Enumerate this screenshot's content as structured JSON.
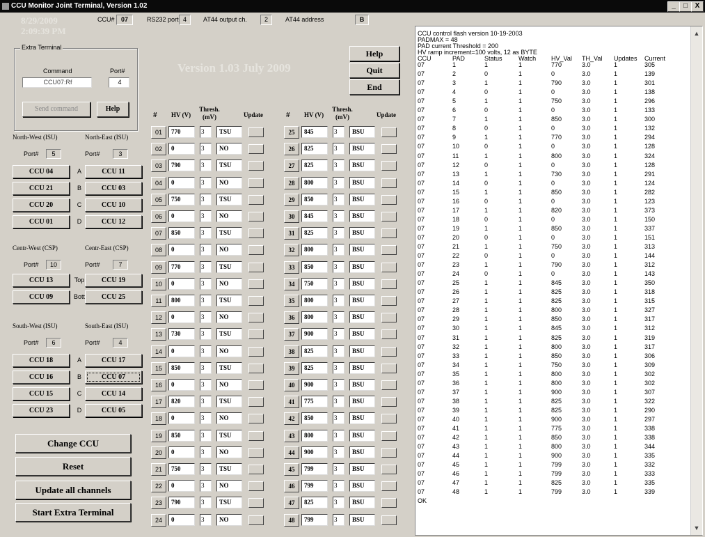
{
  "window": {
    "title": "CCU Monitor Joint Terminal, Version 1.02",
    "controls": [
      "_",
      "□",
      "X"
    ]
  },
  "ghost": {
    "date": "8/29/2009",
    "time": "2:09:39 PM",
    "version": "Version 1.03  July 2009"
  },
  "topbar": {
    "ccu_label": "CCU#",
    "ccu_value": "07",
    "rs232_label": "RS232 port#",
    "rs232_value": "4",
    "at44_ch_label": "AT44 output ch.",
    "at44_ch_value": "2",
    "at44_addr_label": "AT44 address",
    "at44_addr_value": "B"
  },
  "extra_terminal": {
    "title": "Extra Terminal",
    "command_label": "Command",
    "port_label": "Port#",
    "command_value": "CCU07:Rf",
    "port_value": "4",
    "send_label": "Send command",
    "help_label": "Help"
  },
  "side_buttons": {
    "help": "Help",
    "quit": "Quit",
    "end": "End"
  },
  "groups": [
    {
      "left_title": "North-West (ISU)",
      "right_title": "North-East (ISU)",
      "port_label": "Port#",
      "left_port": "5",
      "right_port": "3",
      "rows": [
        {
          "left": "CCU 04",
          "mid": "A",
          "right": "CCU 11"
        },
        {
          "left": "CCU 21",
          "mid": "B",
          "right": "CCU 03"
        },
        {
          "left": "CCU 20",
          "mid": "C",
          "right": "CCU 10"
        },
        {
          "left": "CCU 01",
          "mid": "D",
          "right": "CCU 12"
        }
      ]
    },
    {
      "left_title": "Centr-West (CSP)",
      "right_title": "Centr-East (CSP)",
      "port_label": "Port#",
      "left_port": "10",
      "right_port": "7",
      "rows": [
        {
          "left": "CCU 13",
          "mid": "Top",
          "right": "CCU 19"
        },
        {
          "left": "CCU 09",
          "mid": "Bott",
          "right": "CCU 25"
        }
      ]
    },
    {
      "left_title": "South-West (ISU)",
      "right_title": "South-East (ISU)",
      "port_label": "Port#",
      "left_port": "6",
      "right_port": "4",
      "rows": [
        {
          "left": "CCU 18",
          "mid": "A",
          "right": "CCU 17"
        },
        {
          "left": "CCU 16",
          "mid": "B",
          "right": "CCU 07"
        },
        {
          "left": "CCU 15",
          "mid": "C",
          "right": "CCU 14"
        },
        {
          "left": "CCU 23",
          "mid": "D",
          "right": "CCU 05"
        }
      ]
    }
  ],
  "big_buttons": [
    "Change CCU",
    "Reset",
    "Update all channels",
    "Start Extra Terminal"
  ],
  "channel_headers": {
    "num": "#",
    "hv": "HV (V)",
    "thresh": "Thresh. (mV)",
    "update": "Update"
  },
  "channels_left": [
    {
      "n": "01",
      "hv": "770",
      "th": "3",
      "mode": "TSU"
    },
    {
      "n": "02",
      "hv": "0",
      "th": "3",
      "mode": "NO"
    },
    {
      "n": "03",
      "hv": "790",
      "th": "3",
      "mode": "TSU"
    },
    {
      "n": "04",
      "hv": "0",
      "th": "3",
      "mode": "NO"
    },
    {
      "n": "05",
      "hv": "750",
      "th": "3",
      "mode": "TSU"
    },
    {
      "n": "06",
      "hv": "0",
      "th": "3",
      "mode": "NO"
    },
    {
      "n": "07",
      "hv": "850",
      "th": "3",
      "mode": "TSU"
    },
    {
      "n": "08",
      "hv": "0",
      "th": "3",
      "mode": "NO"
    },
    {
      "n": "09",
      "hv": "770",
      "th": "3",
      "mode": "TSU"
    },
    {
      "n": "10",
      "hv": "0",
      "th": "3",
      "mode": "NO"
    },
    {
      "n": "11",
      "hv": "800",
      "th": "3",
      "mode": "TSU"
    },
    {
      "n": "12",
      "hv": "0",
      "th": "3",
      "mode": "NO"
    },
    {
      "n": "13",
      "hv": "730",
      "th": "3",
      "mode": "TSU"
    },
    {
      "n": "14",
      "hv": "0",
      "th": "3",
      "mode": "NO"
    },
    {
      "n": "15",
      "hv": "850",
      "th": "3",
      "mode": "TSU"
    },
    {
      "n": "16",
      "hv": "0",
      "th": "3",
      "mode": "NO"
    },
    {
      "n": "17",
      "hv": "820",
      "th": "3",
      "mode": "TSU"
    },
    {
      "n": "18",
      "hv": "0",
      "th": "3",
      "mode": "NO"
    },
    {
      "n": "19",
      "hv": "850",
      "th": "3",
      "mode": "TSU"
    },
    {
      "n": "20",
      "hv": "0",
      "th": "3",
      "mode": "NO"
    },
    {
      "n": "21",
      "hv": "750",
      "th": "3",
      "mode": "TSU"
    },
    {
      "n": "22",
      "hv": "0",
      "th": "3",
      "mode": "NO"
    },
    {
      "n": "23",
      "hv": "790",
      "th": "3",
      "mode": "TSU"
    },
    {
      "n": "24",
      "hv": "0",
      "th": "3",
      "mode": "NO"
    }
  ],
  "channels_right": [
    {
      "n": "25",
      "hv": "845",
      "th": "3",
      "mode": "BSU"
    },
    {
      "n": "26",
      "hv": "825",
      "th": "3",
      "mode": "BSU"
    },
    {
      "n": "27",
      "hv": "825",
      "th": "3",
      "mode": "BSU"
    },
    {
      "n": "28",
      "hv": "800",
      "th": "3",
      "mode": "BSU"
    },
    {
      "n": "29",
      "hv": "850",
      "th": "3",
      "mode": "BSU"
    },
    {
      "n": "30",
      "hv": "845",
      "th": "3",
      "mode": "BSU"
    },
    {
      "n": "31",
      "hv": "825",
      "th": "3",
      "mode": "BSU"
    },
    {
      "n": "32",
      "hv": "800",
      "th": "3",
      "mode": "BSU"
    },
    {
      "n": "33",
      "hv": "850",
      "th": "3",
      "mode": "BSU"
    },
    {
      "n": "34",
      "hv": "750",
      "th": "3",
      "mode": "BSU"
    },
    {
      "n": "35",
      "hv": "800",
      "th": "3",
      "mode": "BSU"
    },
    {
      "n": "36",
      "hv": "800",
      "th": "3",
      "mode": "BSU"
    },
    {
      "n": "37",
      "hv": "900",
      "th": "3",
      "mode": "BSU"
    },
    {
      "n": "38",
      "hv": "825",
      "th": "3",
      "mode": "BSU"
    },
    {
      "n": "39",
      "hv": "825",
      "th": "3",
      "mode": "BSU"
    },
    {
      "n": "40",
      "hv": "900",
      "th": "3",
      "mode": "BSU"
    },
    {
      "n": "41",
      "hv": "775",
      "th": "3",
      "mode": "BSU"
    },
    {
      "n": "42",
      "hv": "850",
      "th": "3",
      "mode": "BSU"
    },
    {
      "n": "43",
      "hv": "800",
      "th": "3",
      "mode": "BSU"
    },
    {
      "n": "44",
      "hv": "900",
      "th": "3",
      "mode": "BSU"
    },
    {
      "n": "45",
      "hv": "799",
      "th": "3",
      "mode": "BSU"
    },
    {
      "n": "46",
      "hv": "799",
      "th": "3",
      "mode": "BSU"
    },
    {
      "n": "47",
      "hv": "825",
      "th": "3",
      "mode": "BSU"
    },
    {
      "n": "48",
      "hv": "799",
      "th": "3",
      "mode": "BSU"
    }
  ],
  "output": {
    "lines": [
      "CCU control flash version 10-19-2003",
      "PADMAX = 48",
      "PAD current Threshold = 200",
      "HV ramp increment=100 volts, 12 as BYTE"
    ],
    "columns": [
      "CCU",
      "PAD",
      "Status",
      "Watch",
      "HV_Val",
      "TH_Val",
      "Updates",
      "Current"
    ],
    "rows": [
      [
        "07",
        "1",
        "1",
        "1",
        "770",
        "3.0",
        "1",
        "305"
      ],
      [
        "07",
        "2",
        "0",
        "1",
        "0",
        "3.0",
        "1",
        "139"
      ],
      [
        "07",
        "3",
        "1",
        "1",
        "790",
        "3.0",
        "1",
        "301"
      ],
      [
        "07",
        "4",
        "0",
        "1",
        "0",
        "3.0",
        "1",
        "138"
      ],
      [
        "07",
        "5",
        "1",
        "1",
        "750",
        "3.0",
        "1",
        "296"
      ],
      [
        "07",
        "6",
        "0",
        "1",
        "0",
        "3.0",
        "1",
        "133"
      ],
      [
        "07",
        "7",
        "1",
        "1",
        "850",
        "3.0",
        "1",
        "300"
      ],
      [
        "07",
        "8",
        "0",
        "1",
        "0",
        "3.0",
        "1",
        "132"
      ],
      [
        "07",
        "9",
        "1",
        "1",
        "770",
        "3.0",
        "1",
        "294"
      ],
      [
        "07",
        "10",
        "0",
        "1",
        "0",
        "3.0",
        "1",
        "128"
      ],
      [
        "07",
        "11",
        "1",
        "1",
        "800",
        "3.0",
        "1",
        "324"
      ],
      [
        "07",
        "12",
        "0",
        "1",
        "0",
        "3.0",
        "1",
        "128"
      ],
      [
        "07",
        "13",
        "1",
        "1",
        "730",
        "3.0",
        "1",
        "291"
      ],
      [
        "07",
        "14",
        "0",
        "1",
        "0",
        "3.0",
        "1",
        "124"
      ],
      [
        "07",
        "15",
        "1",
        "1",
        "850",
        "3.0",
        "1",
        "282"
      ],
      [
        "07",
        "16",
        "0",
        "1",
        "0",
        "3.0",
        "1",
        "123"
      ],
      [
        "07",
        "17",
        "1",
        "1",
        "820",
        "3.0",
        "1",
        "373"
      ],
      [
        "07",
        "18",
        "0",
        "1",
        "0",
        "3.0",
        "1",
        "150"
      ],
      [
        "07",
        "19",
        "1",
        "1",
        "850",
        "3.0",
        "1",
        "337"
      ],
      [
        "07",
        "20",
        "0",
        "1",
        "0",
        "3.0",
        "1",
        "151"
      ],
      [
        "07",
        "21",
        "1",
        "1",
        "750",
        "3.0",
        "1",
        "313"
      ],
      [
        "07",
        "22",
        "0",
        "1",
        "0",
        "3.0",
        "1",
        "144"
      ],
      [
        "07",
        "23",
        "1",
        "1",
        "790",
        "3.0",
        "1",
        "312"
      ],
      [
        "07",
        "24",
        "0",
        "1",
        "0",
        "3.0",
        "1",
        "143"
      ],
      [
        "07",
        "25",
        "1",
        "1",
        "845",
        "3.0",
        "1",
        "350"
      ],
      [
        "07",
        "26",
        "1",
        "1",
        "825",
        "3.0",
        "1",
        "318"
      ],
      [
        "07",
        "27",
        "1",
        "1",
        "825",
        "3.0",
        "1",
        "315"
      ],
      [
        "07",
        "28",
        "1",
        "1",
        "800",
        "3.0",
        "1",
        "327"
      ],
      [
        "07",
        "29",
        "1",
        "1",
        "850",
        "3.0",
        "1",
        "317"
      ],
      [
        "07",
        "30",
        "1",
        "1",
        "845",
        "3.0",
        "1",
        "312"
      ],
      [
        "07",
        "31",
        "1",
        "1",
        "825",
        "3.0",
        "1",
        "319"
      ],
      [
        "07",
        "32",
        "1",
        "1",
        "800",
        "3.0",
        "1",
        "317"
      ],
      [
        "07",
        "33",
        "1",
        "1",
        "850",
        "3.0",
        "1",
        "306"
      ],
      [
        "07",
        "34",
        "1",
        "1",
        "750",
        "3.0",
        "1",
        "309"
      ],
      [
        "07",
        "35",
        "1",
        "1",
        "800",
        "3.0",
        "1",
        "302"
      ],
      [
        "07",
        "36",
        "1",
        "1",
        "800",
        "3.0",
        "1",
        "302"
      ],
      [
        "07",
        "37",
        "1",
        "1",
        "900",
        "3.0",
        "1",
        "307"
      ],
      [
        "07",
        "38",
        "1",
        "1",
        "825",
        "3.0",
        "1",
        "322"
      ],
      [
        "07",
        "39",
        "1",
        "1",
        "825",
        "3.0",
        "1",
        "290"
      ],
      [
        "07",
        "40",
        "1",
        "1",
        "900",
        "3.0",
        "1",
        "297"
      ],
      [
        "07",
        "41",
        "1",
        "1",
        "775",
        "3.0",
        "1",
        "338"
      ],
      [
        "07",
        "42",
        "1",
        "1",
        "850",
        "3.0",
        "1",
        "338"
      ],
      [
        "07",
        "43",
        "1",
        "1",
        "800",
        "3.0",
        "1",
        "344"
      ],
      [
        "07",
        "44",
        "1",
        "1",
        "900",
        "3.0",
        "1",
        "335"
      ],
      [
        "07",
        "45",
        "1",
        "1",
        "799",
        "3.0",
        "1",
        "332"
      ],
      [
        "07",
        "46",
        "1",
        "1",
        "799",
        "3.0",
        "1",
        "333"
      ],
      [
        "07",
        "47",
        "1",
        "1",
        "825",
        "3.0",
        "1",
        "335"
      ],
      [
        "07",
        "48",
        "1",
        "1",
        "799",
        "3.0",
        "1",
        "339"
      ]
    ],
    "tail": "OK"
  }
}
